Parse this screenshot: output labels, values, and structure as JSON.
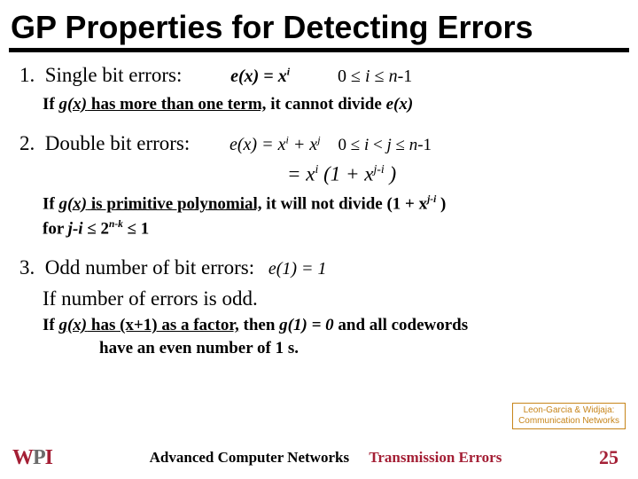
{
  "title": "GP Properties for Detecting Errors",
  "items": {
    "one": {
      "num": "1.",
      "label": "Single bit errors:",
      "eq_lhs": "e(x) = x",
      "eq_exp": "i",
      "range": "0 ≤ i ≤ n-1",
      "note_a": "If ",
      "note_gx": "g(x)",
      "note_b": " has more than one term,",
      "note_c": "  it cannot divide ",
      "note_ex": "e(x)"
    },
    "two": {
      "num": "2.",
      "label": "Double bit errors:",
      "eq1_pre": "e(x) =   x",
      "eq1_exp1": "i",
      "eq1_mid": " +  x",
      "eq1_exp2": "j",
      "range": "0 ≤ i < j ≤ n-1",
      "eq2_pre": "=   x",
      "eq2_exp1": "i",
      "eq2_mid": " (1 +   x",
      "eq2_exp2": "j-i",
      "eq2_end": " )",
      "note_a": "If ",
      "note_gx": "g(x)",
      "note_b": " is primitive polynomial,",
      "note_c": " it will not divide (1 +  x",
      "note_exp": "j-i",
      "note_d": " )",
      "note_line2a": "for ",
      "note_line2b": "j-i",
      "note_line2c": " ≤ 2",
      "note_line2exp": "n-k",
      "note_line2d": " ≤ 1"
    },
    "three": {
      "num": "3.",
      "label": "Odd number of bit errors:",
      "eq": "e(1) = 1",
      "line2": "If number of errors is odd.",
      "note_a": "If ",
      "note_gx": "g(x)",
      "note_b": " has (x+1) as a factor,",
      "note_c": " then ",
      "note_g1": "g(1) = 0 ",
      "note_d": "and all codewords",
      "note_line2": "have an even number of 1 s."
    }
  },
  "attribution": {
    "line1": "Leon-Garcia & Widjaja:",
    "line2": "Communication Networks"
  },
  "footer": {
    "logo_w": "W",
    "logo_p": "P",
    "logo_i": "I",
    "center_black": "Advanced Computer Networks",
    "center_red": "Transmission Errors",
    "page": "25"
  }
}
